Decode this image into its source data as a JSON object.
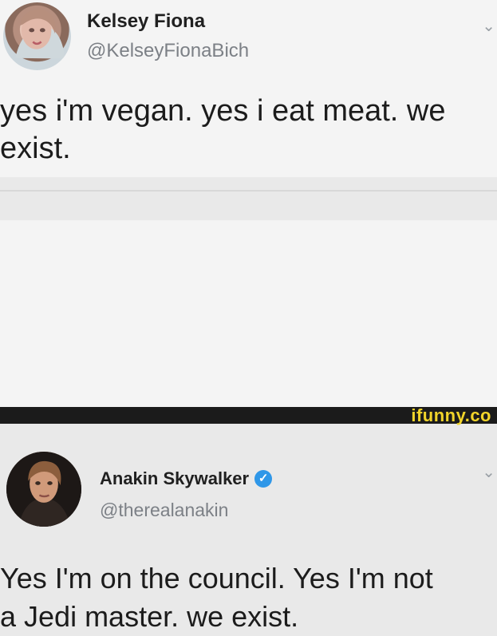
{
  "tweets": [
    {
      "name": "Kelsey Fiona",
      "handle": "@KelseyFionaBich",
      "text": "yes i'm vegan. yes i eat meat. we\nexist."
    },
    {
      "name": "Anakin Skywalker",
      "handle": "@therealanakin",
      "verified_mark": "✓",
      "text": "Yes I'm on the council. Yes I'm not\na Jedi master. we exist."
    }
  ],
  "watermark": {
    "label": "ifunny.co",
    "color": "#f1d42a"
  },
  "icons": {
    "verified": "verified-badge-icon",
    "chevron": "chevron-down-icon"
  },
  "colors": {
    "background": "#f4f4f4",
    "name": "#202020",
    "handle": "#7c8086",
    "verified": "#2f97e8"
  }
}
